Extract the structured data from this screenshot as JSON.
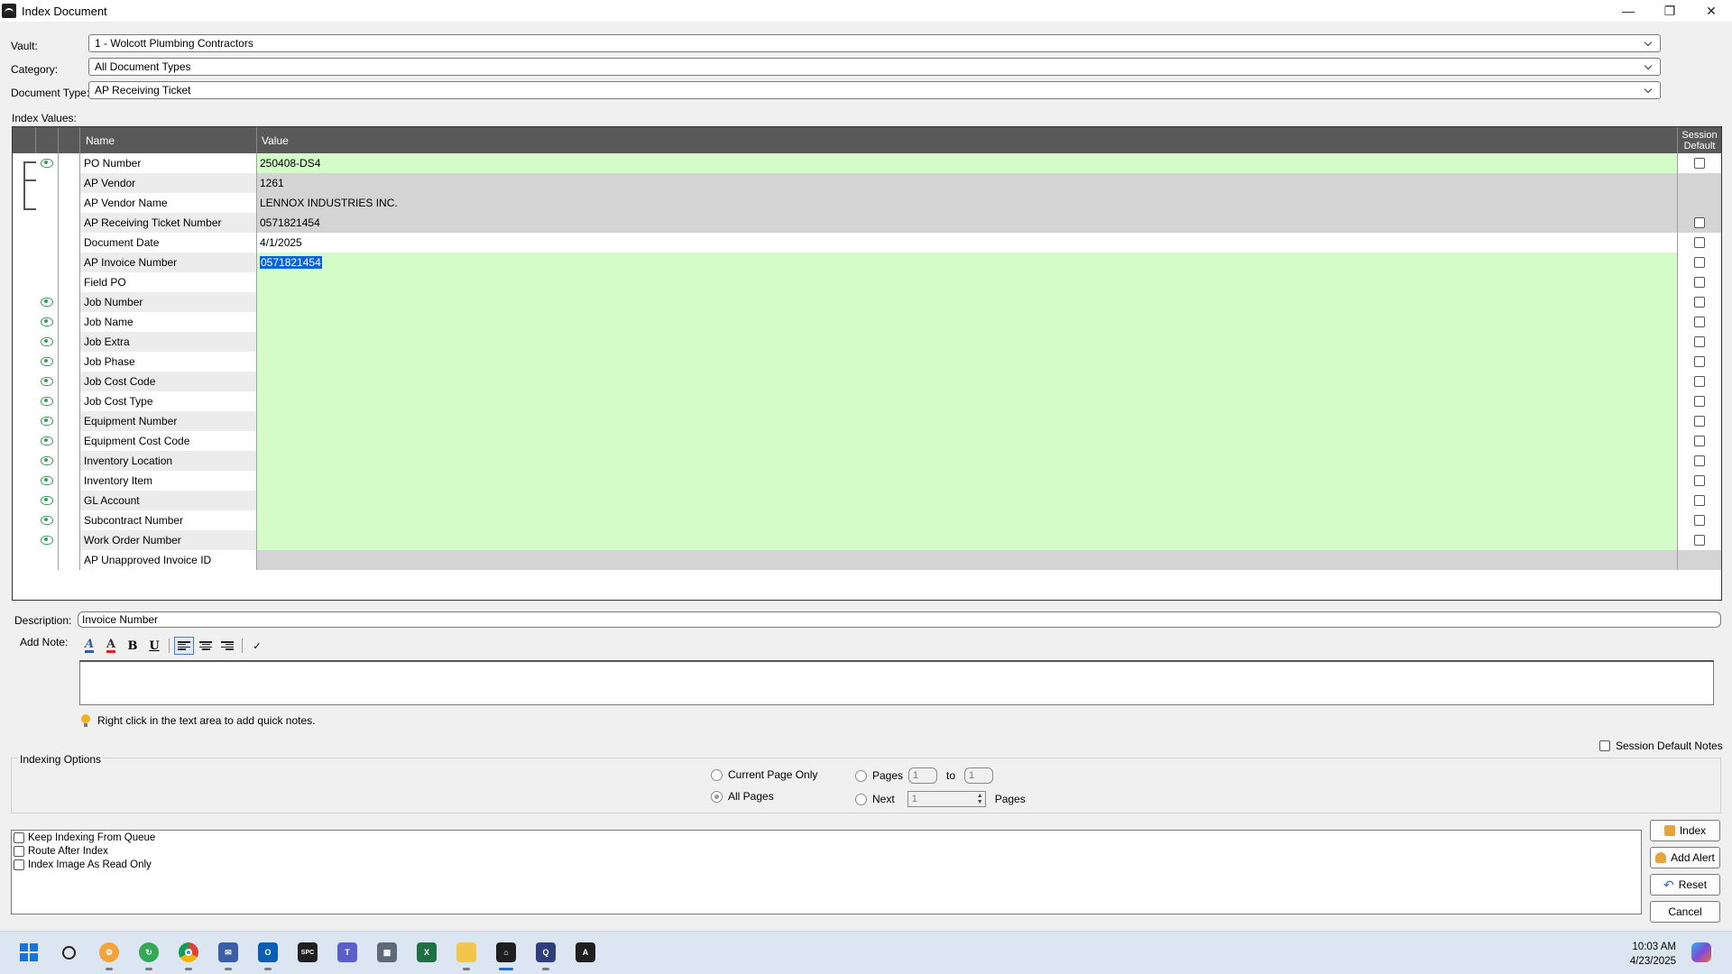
{
  "window": {
    "title": "Index Document"
  },
  "selectors": {
    "vault_label": "Vault:",
    "vault_value": "1 - Wolcott Plumbing Contractors",
    "category_label": "Category:",
    "category_value": "All Document Types",
    "doctype_label": "Document Type:",
    "doctype_value": "AP Receiving Ticket"
  },
  "grid": {
    "section_label": "Index Values:",
    "headers": {
      "name": "Name",
      "value": "Value",
      "session_default_1": "Session",
      "session_default_2": "Default"
    },
    "rows": [
      {
        "name": "PO Number",
        "value": "250408-DS4",
        "eye": true,
        "bg": "green",
        "cb": true
      },
      {
        "name": "AP Vendor",
        "value": "1261",
        "eye": false,
        "bg": "gray",
        "cb": false
      },
      {
        "name": "AP Vendor Name",
        "value": "LENNOX INDUSTRIES INC.",
        "eye": false,
        "bg": "gray",
        "cb": false
      },
      {
        "name": "AP Receiving Ticket Number",
        "value": "0571821454",
        "eye": false,
        "bg": "gray",
        "cb": true
      },
      {
        "name": "Document Date",
        "value": "4/1/2025",
        "eye": false,
        "bg": "white",
        "cb": true
      },
      {
        "name": "AP Invoice Number",
        "value": "0571821454",
        "eye": false,
        "bg": "green",
        "cb": true,
        "selected": true
      },
      {
        "name": "Field PO",
        "value": "",
        "eye": false,
        "bg": "green",
        "cb": true
      },
      {
        "name": "Job Number",
        "value": "",
        "eye": true,
        "bg": "green",
        "cb": true
      },
      {
        "name": "Job Name",
        "value": "",
        "eye": true,
        "bg": "green",
        "cb": true
      },
      {
        "name": "Job Extra",
        "value": "",
        "eye": true,
        "bg": "green",
        "cb": true
      },
      {
        "name": "Job Phase",
        "value": "",
        "eye": true,
        "bg": "green",
        "cb": true
      },
      {
        "name": "Job Cost Code",
        "value": "",
        "eye": true,
        "bg": "green",
        "cb": true
      },
      {
        "name": "Job Cost Type",
        "value": "",
        "eye": true,
        "bg": "green",
        "cb": true
      },
      {
        "name": "Equipment Number",
        "value": "",
        "eye": true,
        "bg": "green",
        "cb": true
      },
      {
        "name": "Equipment Cost Code",
        "value": "",
        "eye": true,
        "bg": "green",
        "cb": true
      },
      {
        "name": "Inventory Location",
        "value": "",
        "eye": true,
        "bg": "green",
        "cb": true
      },
      {
        "name": "Inventory Item",
        "value": "",
        "eye": true,
        "bg": "green",
        "cb": true
      },
      {
        "name": "GL Account",
        "value": "",
        "eye": true,
        "bg": "green",
        "cb": true
      },
      {
        "name": "Subcontract Number",
        "value": "",
        "eye": true,
        "bg": "green",
        "cb": true
      },
      {
        "name": "Work Order Number",
        "value": "",
        "eye": true,
        "bg": "green",
        "cb": true
      },
      {
        "name": "AP Unapproved Invoice ID",
        "value": "",
        "eye": false,
        "bg": "gray",
        "cb": false
      }
    ]
  },
  "description": {
    "label": "Description:",
    "value": "Invoice Number"
  },
  "note": {
    "label": "Add Note:",
    "hint": "Right click in the text area to add quick notes.",
    "session_default_notes": "Session Default Notes"
  },
  "indexing_options": {
    "legend": "Indexing Options",
    "current_page_only": "Current Page Only",
    "all_pages": "All Pages",
    "pages_label": "Pages",
    "pages_from": "1",
    "to_label": "to",
    "pages_to": "1",
    "next_label": "Next",
    "next_value": "1",
    "next_pages_label": "Pages"
  },
  "queue_options": {
    "keep_indexing": "Keep Indexing From Queue",
    "route_after": "Route After Index",
    "read_only": "Index Image As Read Only"
  },
  "buttons": {
    "index": "Index",
    "add_alert": "Add Alert",
    "reset": "Reset",
    "cancel": "Cancel"
  },
  "clock": {
    "time": "10:03 AM",
    "date": "4/23/2025"
  },
  "colors": {
    "green_row": "#d4fcc8",
    "gray_row": "#d4d4d4",
    "header": "#595959",
    "accent": "#1a6fd1"
  }
}
